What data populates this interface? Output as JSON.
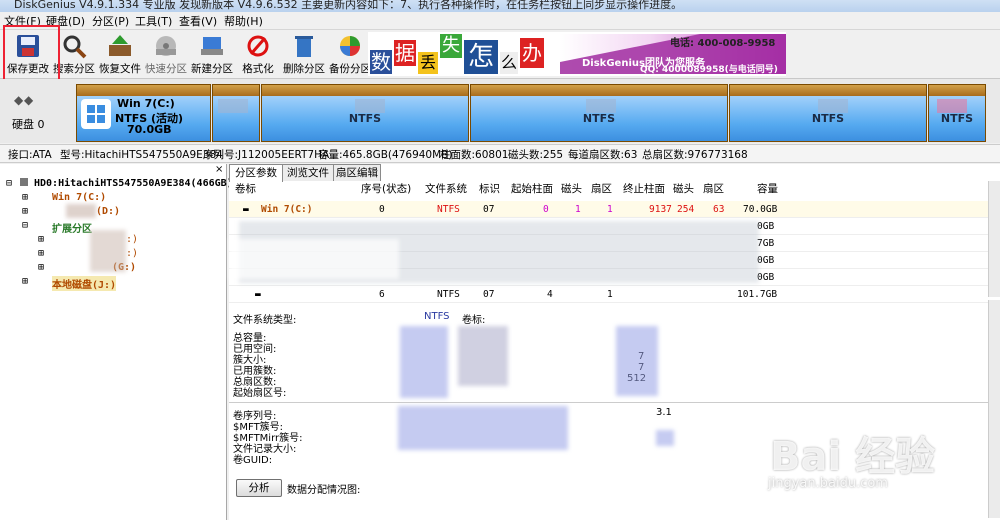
{
  "window": {
    "title": "DiskGenius V4.9.1.334 专业版  发现新版本 V4.9.6.532 主要更新内容如下：7、执行各种操作时，在任务栏按钮上同步显示操作进度。"
  },
  "menu": [
    "文件(F)",
    "硬盘(D)",
    "分区(P)",
    "工具(T)",
    "查看(V)",
    "帮助(H)"
  ],
  "toolbar": {
    "buttons": [
      {
        "label": "保存更改",
        "icon": "save-disk-icon"
      },
      {
        "label": "搜索分区",
        "icon": "search-magnifier-icon"
      },
      {
        "label": "恢复文件",
        "icon": "recover-files-icon"
      },
      {
        "label": "快速分区",
        "icon": "quick-partition-icon"
      },
      {
        "label": "新建分区",
        "icon": "new-partition-icon"
      },
      {
        "label": "格式化",
        "icon": "format-icon"
      },
      {
        "label": "删除分区",
        "icon": "delete-partition-icon"
      },
      {
        "label": "备份分区",
        "icon": "backup-partition-icon"
      }
    ]
  },
  "banner": {
    "chars": [
      "数",
      "据",
      "丢",
      "失",
      "怎",
      "么",
      "办"
    ],
    "brand": "DiskGenius团队为您服务",
    "phone": "电话: 400-008-9958",
    "qq": "QQ: 4000089958(与电话同号)"
  },
  "diskmap": {
    "disk_label": "硬盘 0",
    "first": {
      "name": "Win 7(C:)",
      "fs": "NTFS (活动)",
      "size": "70.0GB"
    },
    "segments": [
      "NTFS",
      "NTFS",
      "NTFS",
      "NTFS"
    ]
  },
  "info": {
    "iface": "接口:ATA",
    "model": "型号:HitachiHTS547550A9E384",
    "serial": "序列号:J112005EERT7HA",
    "capacity": "容量:465.8GB(476940MB)",
    "cyl": "柱面数:60801",
    "heads": "磁头数:255",
    "spt": "每道扇区数:63",
    "sectors": "总扇区数:976773168"
  },
  "tree": {
    "root": "HD0:HitachiHTS547550A9E384(466GB)",
    "c": "Win 7(C:)",
    "d": "(D:)",
    "ext": "扩展分区",
    "e": ":)",
    "f": ":)",
    "g": "(G:)",
    "local": "本地磁盘(J:)"
  },
  "tabs": [
    "分区参数",
    "浏览文件",
    "扇区编辑"
  ],
  "table": {
    "headers": [
      "卷标",
      "序号(状态)",
      "文件系统",
      "标识",
      "起始柱面",
      "磁头",
      "扇区",
      "终止柱面",
      "磁头",
      "扇区",
      "容量"
    ],
    "rows": [
      [
        "Win 7(C:)",
        "0",
        "NTFS",
        "07",
        "0",
        "1",
        "1",
        "9137",
        "254",
        "63",
        "70.0GB"
      ],
      [
        "",
        "",
        "",
        "",
        "",
        "",
        "",
        "",
        "",
        "",
        "0GB"
      ],
      [
        "",
        "",
        "",
        "",
        "",
        "",
        "",
        "",
        "",
        "",
        "7GB"
      ],
      [
        "",
        "",
        "",
        "",
        "",
        "",
        "",
        "",
        "",
        "",
        "0GB"
      ],
      [
        "",
        "",
        "",
        "",
        "",
        "",
        "",
        "",
        "",
        "",
        "0GB"
      ],
      [
        "",
        "6",
        "NTFS",
        "07",
        "4",
        "",
        "1",
        "",
        "",
        "",
        "101.7GB"
      ]
    ]
  },
  "details": {
    "fs_type_label": "文件系统类型:",
    "fs_type": "NTFS",
    "vol_label": "卷标:",
    "lines1": [
      "总容量:",
      "已用空间:",
      "簇大小:",
      "已用簇数:",
      "总扇区数:",
      "起始扇区号:"
    ],
    "vals1": [
      "7",
      "7",
      "512"
    ],
    "lines2": [
      "卷序列号:",
      "$MFT簇号:",
      "$MFTMirr簇号:",
      "文件记录大小:",
      "卷GUID:"
    ],
    "ver": "3.1",
    "analyze_btn": "分析",
    "dist_label": "数据分配情况图:"
  },
  "watermark": {
    "main": "Bai 经验",
    "sub": "jingyan.baidu.com"
  }
}
